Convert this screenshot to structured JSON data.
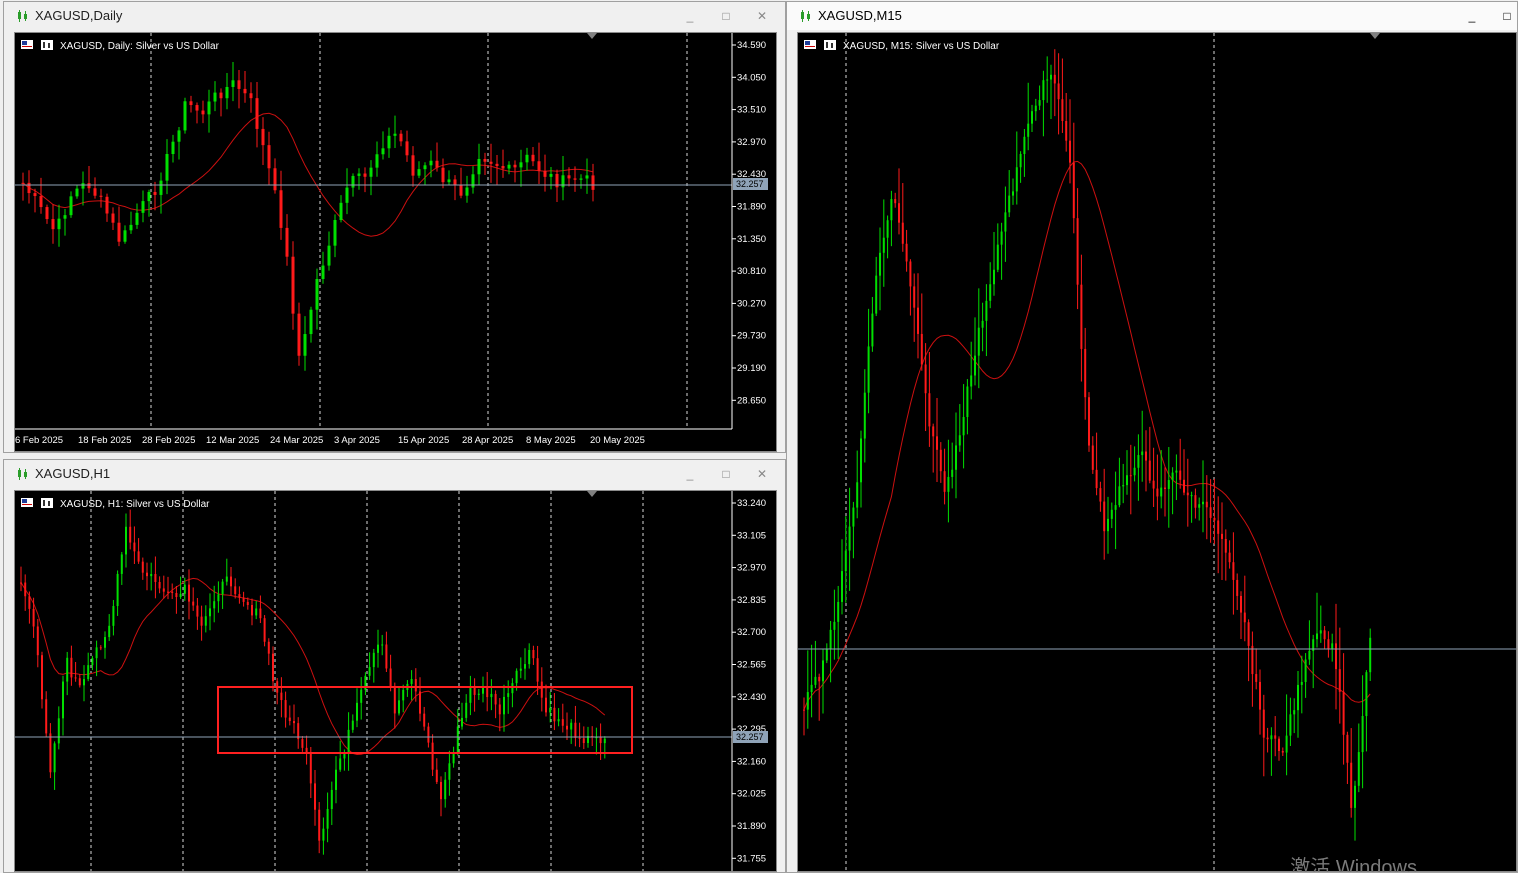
{
  "colors": {
    "background": "#000000",
    "up": "#00e000",
    "down": "#ff1a1a",
    "ma": "#cc1010",
    "grid": "#ffffff",
    "price_line": "#8fa3b8",
    "box": "#ff2020"
  },
  "windows": [
    {
      "id": "daily",
      "title": "XAGUSD,Daily",
      "header": "XAGUSD, Daily:  Silver vs US Dollar",
      "price_axis": [
        "34.590",
        "34.050",
        "33.510",
        "32.970",
        "32.430",
        "31.890",
        "31.350",
        "30.810",
        "30.270",
        "29.730",
        "29.190",
        "28.650"
      ],
      "current_price": "32.257",
      "time_axis": [
        "6 Feb 2025",
        "18 Feb 2025",
        "28 Feb 2025",
        "12 Mar 2025",
        "24 Mar 2025",
        "3 Apr 2025",
        "15 Apr 2025",
        "28 Apr 2025",
        "8 May 2025",
        "20 May 2025"
      ],
      "buttons": {
        "minimize": "_",
        "maximize": "□",
        "close": "✕"
      }
    },
    {
      "id": "h1",
      "title": "XAGUSD,H1",
      "header": "XAGUSD, H1:  Silver vs US Dollar",
      "price_axis": [
        "33.240",
        "33.105",
        "32.970",
        "32.835",
        "32.700",
        "32.565",
        "32.430",
        "32.295",
        "32.160",
        "32.025",
        "31.890",
        "31.755"
      ],
      "current_price": "32.257",
      "buttons": {
        "minimize": "_",
        "maximize": "□",
        "close": "✕"
      }
    },
    {
      "id": "m15",
      "title": "XAGUSD,M15",
      "header": "XAGUSD, M15:  Silver vs US Dollar",
      "buttons": {
        "minimize": "_",
        "maximize": "□"
      }
    }
  ],
  "watermark": "激活 Windows"
}
